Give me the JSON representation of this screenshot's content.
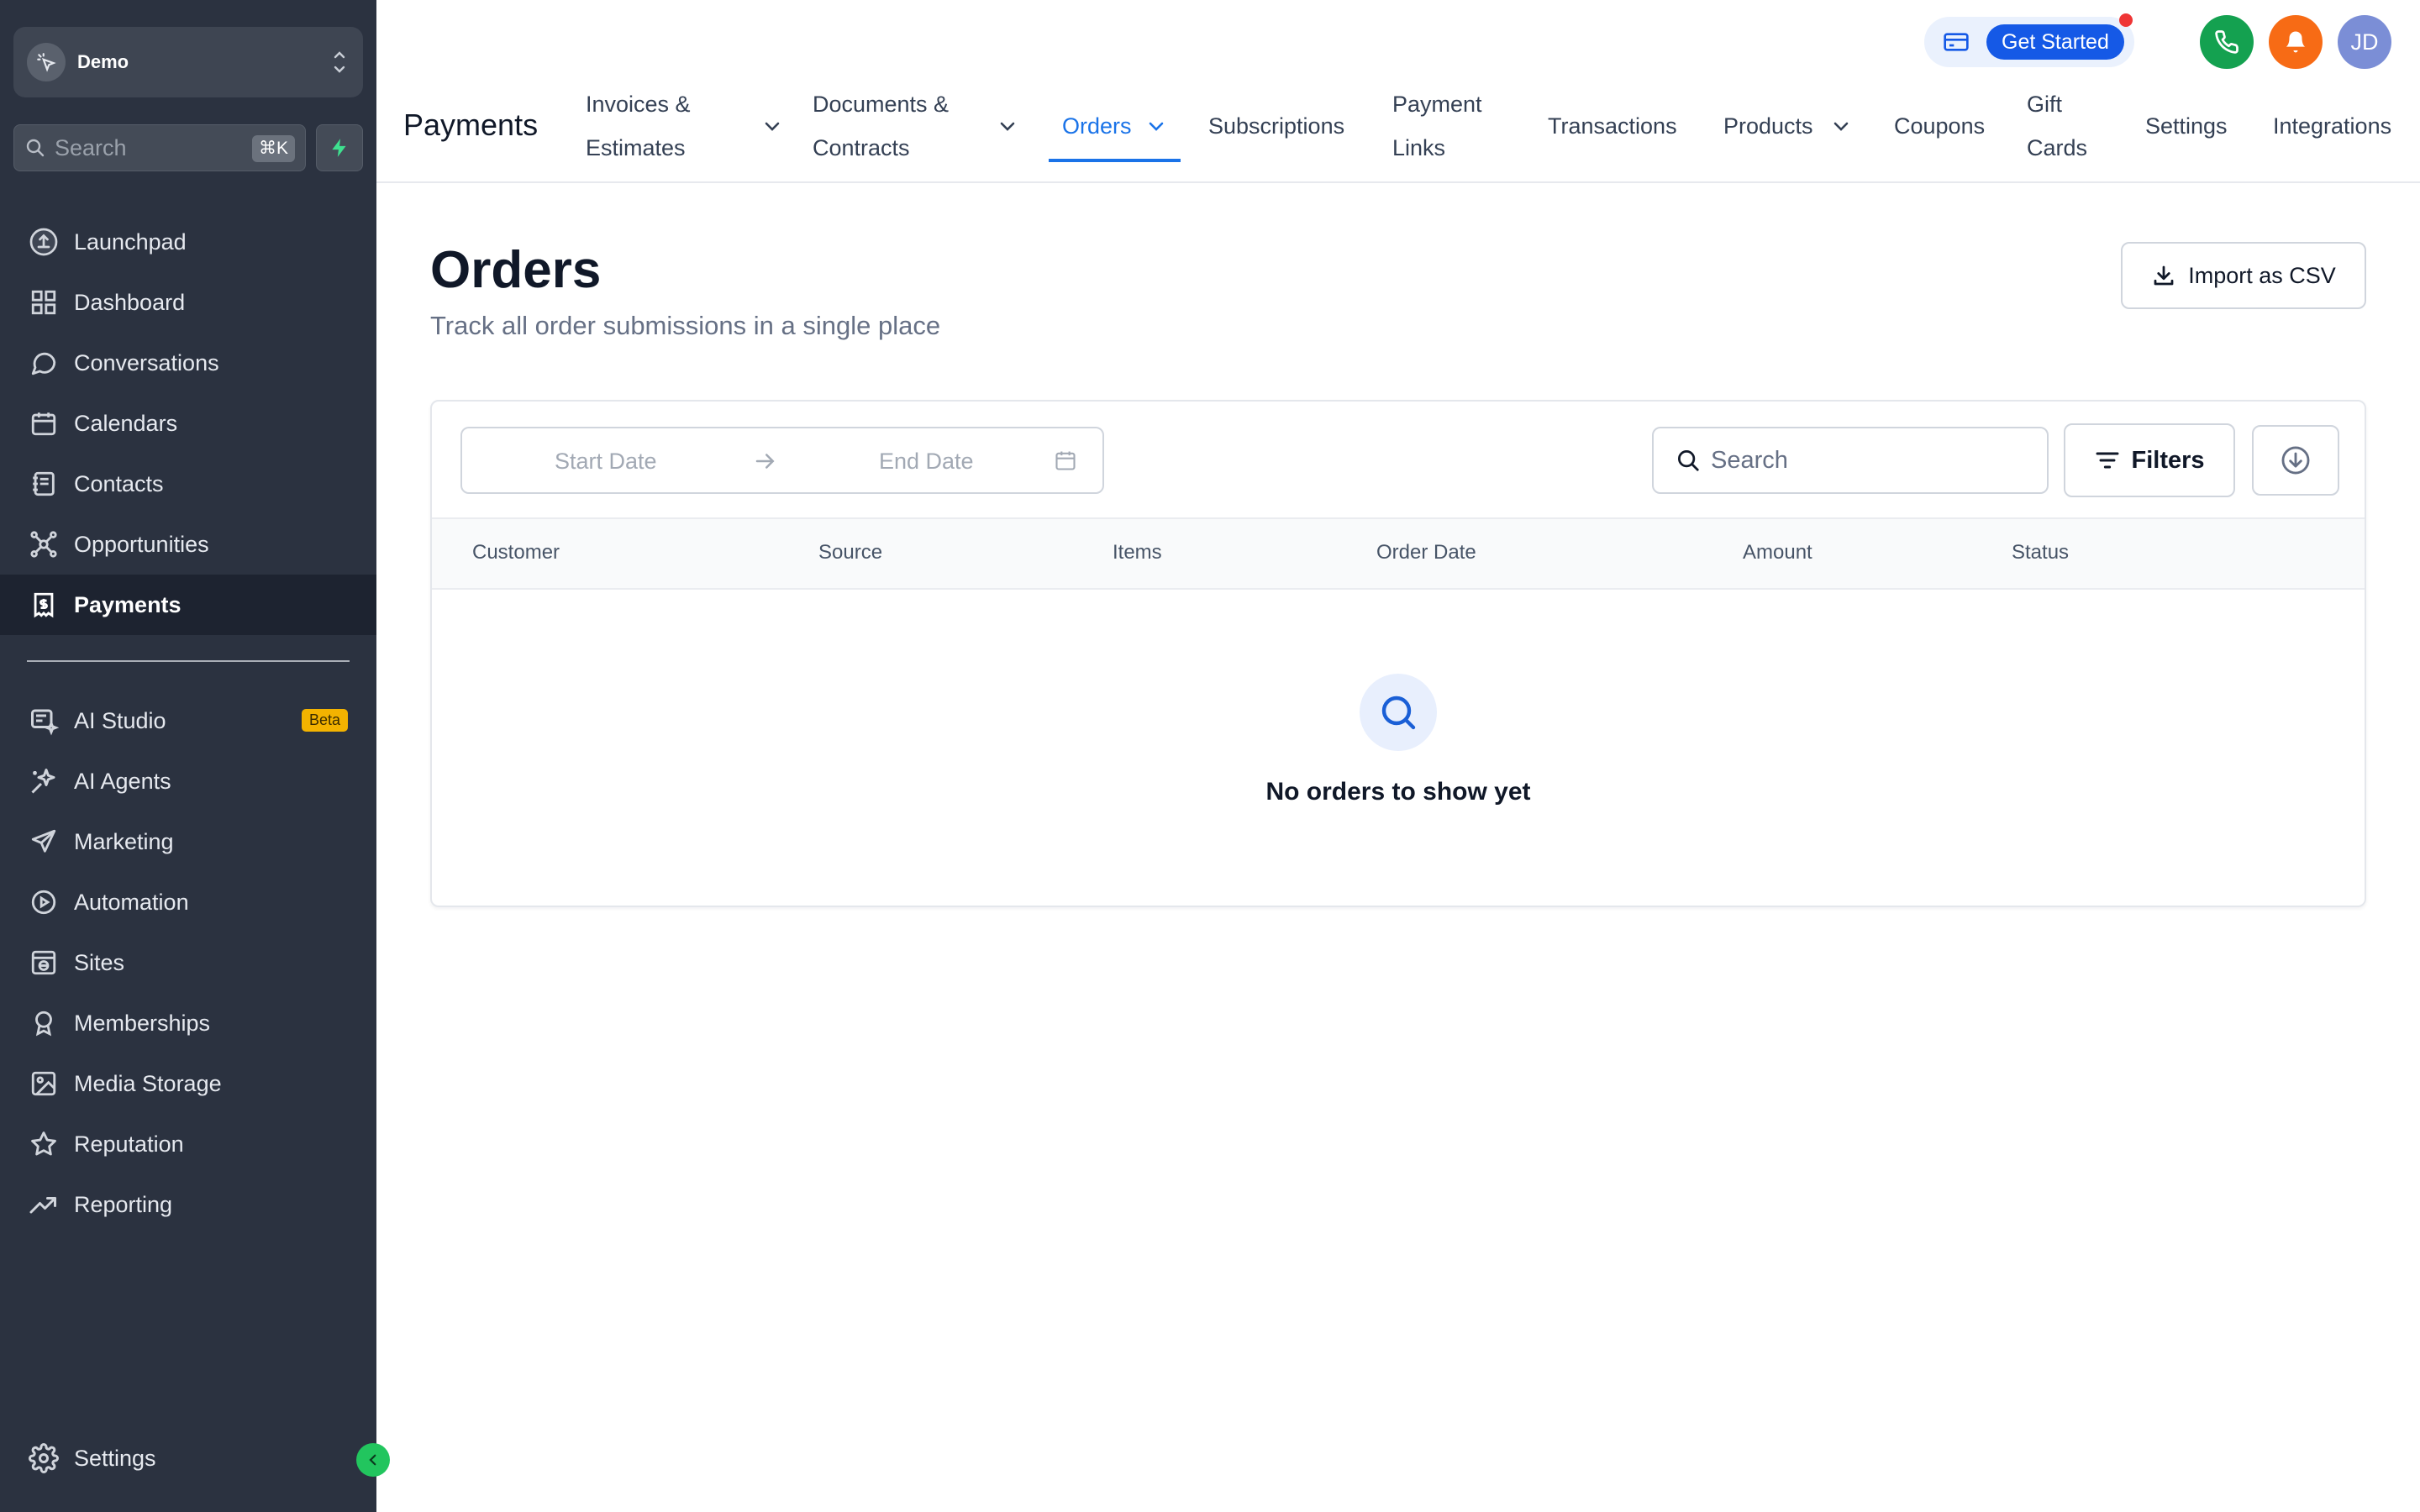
{
  "sidebar": {
    "account_name": "Demo",
    "search_placeholder": "Search",
    "search_shortcut": "⌘K",
    "items": [
      {
        "label": "Launchpad",
        "icon": "launchpad-icon"
      },
      {
        "label": "Dashboard",
        "icon": "dashboard-icon"
      },
      {
        "label": "Conversations",
        "icon": "chat-icon"
      },
      {
        "label": "Calendars",
        "icon": "calendar-icon"
      },
      {
        "label": "Contacts",
        "icon": "contacts-icon"
      },
      {
        "label": "Opportunities",
        "icon": "opportunities-icon"
      },
      {
        "label": "Payments",
        "icon": "payments-icon",
        "active": true
      }
    ],
    "items2": [
      {
        "label": "AI Studio",
        "icon": "ai-studio-icon",
        "badge": "Beta"
      },
      {
        "label": "AI Agents",
        "icon": "sparkle-icon"
      },
      {
        "label": "Marketing",
        "icon": "send-icon"
      },
      {
        "label": "Automation",
        "icon": "automation-icon"
      },
      {
        "label": "Sites",
        "icon": "sites-icon"
      },
      {
        "label": "Memberships",
        "icon": "badge-icon"
      },
      {
        "label": "Media Storage",
        "icon": "image-icon"
      },
      {
        "label": "Reputation",
        "icon": "star-icon"
      },
      {
        "label": "Reporting",
        "icon": "trend-icon"
      }
    ],
    "settings_label": "Settings"
  },
  "topbar": {
    "get_started": "Get Started",
    "avatar_initials": "JD",
    "section_title": "Payments",
    "tabs": [
      {
        "line1": "Invoices &",
        "line2": "Estimates",
        "dropdown": true
      },
      {
        "line1": "Documents &",
        "line2": "Contracts",
        "dropdown": true
      },
      {
        "label": "Orders",
        "dropdown": true,
        "active": true
      },
      {
        "label": "Subscriptions"
      },
      {
        "line1": "Payment",
        "line2": "Links"
      },
      {
        "label": "Transactions"
      },
      {
        "label": "Products",
        "dropdown": true
      },
      {
        "label": "Coupons"
      },
      {
        "line1": "Gift",
        "line2": "Cards"
      },
      {
        "label": "Settings"
      },
      {
        "label": "Integrations"
      }
    ]
  },
  "main": {
    "title": "Orders",
    "subtitle": "Track all order submissions in a single place",
    "import_label": "Import as CSV",
    "date_start_placeholder": "Start Date",
    "date_end_placeholder": "End Date",
    "search_placeholder": "Search",
    "filters_label": "Filters",
    "columns": [
      "Customer",
      "Source",
      "Items",
      "Order Date",
      "Amount",
      "Status"
    ],
    "empty_message": "No orders to show yet"
  },
  "colors": {
    "sidebar_bg": "#2b3240",
    "sidebar_active": "#1d2330",
    "accent_blue": "#1a73e8",
    "get_started_bg": "#1559e6",
    "phone_green": "#14a150",
    "bell_orange": "#f76b15",
    "beta_badge": "#f3b300",
    "collapse_green": "#22c55e"
  }
}
